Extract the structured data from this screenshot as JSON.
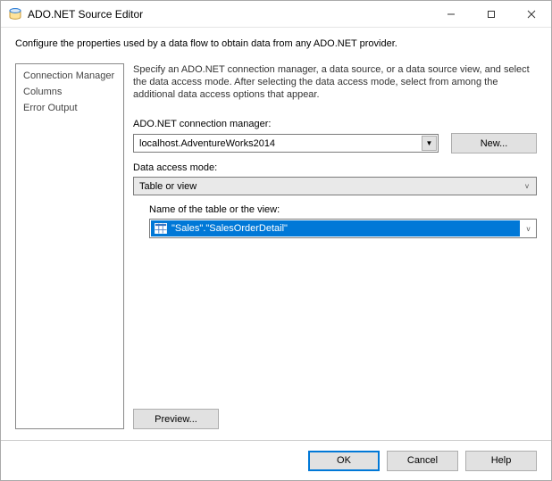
{
  "window": {
    "title": "ADO.NET Source Editor"
  },
  "subheader": "Configure the properties used by a data flow to obtain data from any ADO.NET provider.",
  "sidebar": {
    "items": [
      {
        "label": "Connection Manager"
      },
      {
        "label": "Columns"
      },
      {
        "label": "Error Output"
      }
    ]
  },
  "main": {
    "description": "Specify an ADO.NET connection manager, a data source, or a data source view, and select the data access mode. After selecting the data access mode, select from among the additional data access options that appear.",
    "connmgr_label": "ADO.NET connection manager:",
    "connmgr_value": "localhost.AdventureWorks2014",
    "new_btn": "New...",
    "mode_label": "Data access mode:",
    "mode_value": "Table or view",
    "table_label": "Name of the table or the view:",
    "table_value": "\"Sales\".\"SalesOrderDetail\"",
    "preview_btn": "Preview..."
  },
  "footer": {
    "ok": "OK",
    "cancel": "Cancel",
    "help": "Help"
  }
}
